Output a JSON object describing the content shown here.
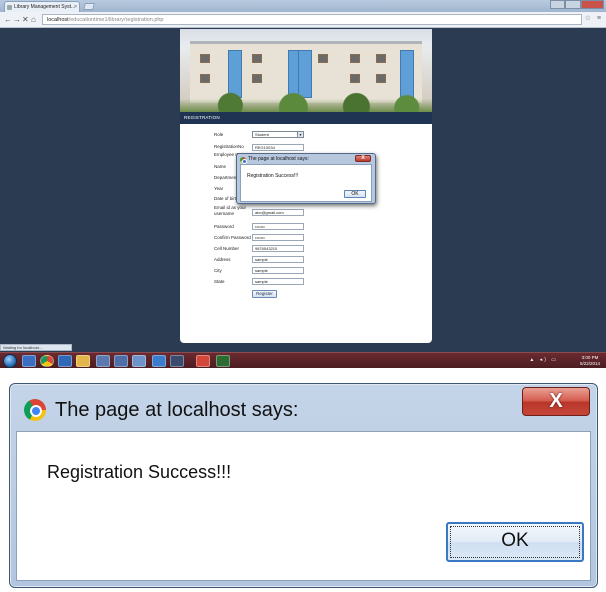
{
  "browser": {
    "tab_title": "Library Management Syst...",
    "tab_close": "×",
    "url_host": "localhost",
    "url_path": "/educationtime1/library/registration.php",
    "back": "←",
    "forward": "→",
    "reload": "✕",
    "home": "⌂",
    "toolbar_icons": "☆ ≡"
  },
  "page": {
    "section_header": "REGISTRATION",
    "form": {
      "role_label": "Role",
      "role_value": "Student",
      "regd_label": "RegistrationNo",
      "regd_value": "REG10034",
      "employee_label": "Employee ID",
      "name_label": "Name",
      "department_label": "Department",
      "year_label": "Year",
      "dob_label": "Date of birth",
      "email_label": "Email id as your username",
      "email_value": "abc@gmail.com",
      "password_label": "Password",
      "password_value": "•••••••",
      "confirm_label": "Confirm Password",
      "confirm_value": "•••••••",
      "cell_label": "Cell Number",
      "cell_value": "9876543210",
      "address_label": "Address",
      "address_value": "sample",
      "city_label": "City",
      "city_value": "sample",
      "state_label": "State",
      "state_value": "sample",
      "register_label": "Register"
    }
  },
  "status_bar": "Waiting for localhost...",
  "taskbar": {
    "clock_time": "3:00 PM",
    "clock_date": "5/22/2014",
    "tray": "▲ ◂) ▭"
  },
  "dialog": {
    "title": "The page at localhost says:",
    "message": "Registration Success!!!",
    "ok_label": "OK",
    "close_label": "X"
  },
  "colors": {
    "desktop_bg": "#2b3c52",
    "header_bar": "#1e3452",
    "taskbar": "#5a2328",
    "ok_border": "#3b78c4",
    "close_red": "#c5473a"
  }
}
